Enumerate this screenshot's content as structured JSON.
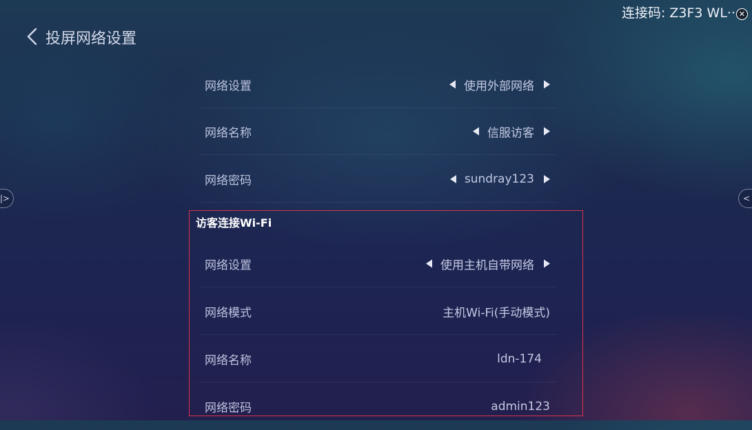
{
  "connection": {
    "code_text": "连接码: Z3F3 WL··",
    "close_glyph": "✕"
  },
  "header": {
    "title": "投屏网络设置"
  },
  "edge_handles": {
    "left_glyph": "|>",
    "right_glyph": "<"
  },
  "main_settings": [
    {
      "label": "网络设置",
      "value": "使用外部网络",
      "has_arrows": true
    },
    {
      "label": "网络名称",
      "value": "信服访客",
      "has_arrows": true
    },
    {
      "label": "网络密码",
      "value": "sundray123",
      "has_arrows": true
    }
  ],
  "guest_section": {
    "title": "访客连接Wi-Fi",
    "rows": [
      {
        "label": "网络设置",
        "value": "使用主机自带网络",
        "has_arrows": true
      },
      {
        "label": "网络模式",
        "value": "主机Wi-Fi(手动模式)",
        "has_arrows": false
      },
      {
        "label": "网络名称",
        "value": "ldn-174",
        "has_arrows": false
      },
      {
        "label": "网络密码",
        "value": "admin123",
        "has_arrows": false
      }
    ]
  },
  "colors": {
    "highlight_border": "#d8344a",
    "bg_top": "#1d3a55",
    "bg_bottom": "#221f4e"
  },
  "icons": {
    "back": "chevron-left-icon",
    "prev": "triangle-left-icon",
    "next": "triangle-right-icon",
    "close": "close-icon"
  }
}
